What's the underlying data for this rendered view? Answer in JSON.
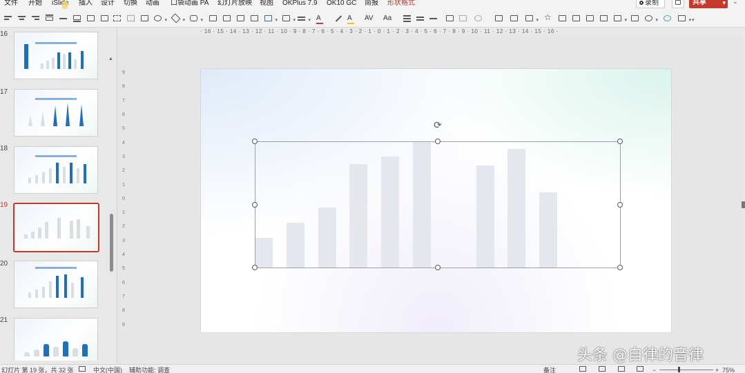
{
  "menu": {
    "items": [
      "文件",
      "开始",
      "iSlide",
      "插入",
      "设计",
      "切换",
      "动画",
      "口袋动画 PA",
      "幻灯片放映",
      "视图",
      "OKPlus 7.9",
      "OK10 GC",
      "简报",
      "形状格式"
    ],
    "active_index": 13,
    "record_label": "录制",
    "share_label": "共享"
  },
  "toolbar": {
    "font_size_label": "Aa",
    "text_color": "#c0392b",
    "highlight_color": "#f1c40f"
  },
  "thumbnails": [
    {
      "number": "16",
      "active": false,
      "style": "blue_bars"
    },
    {
      "number": "17",
      "active": false,
      "style": "triangles"
    },
    {
      "number": "18",
      "active": false,
      "style": "blue_bars_grid"
    },
    {
      "number": "19",
      "active": true,
      "style": "gray_bars"
    },
    {
      "number": "20",
      "active": false,
      "style": "blue_bars_grid"
    },
    {
      "number": "21",
      "active": false,
      "style": "rounded_bars"
    }
  ],
  "ruler": {
    "horizontal": "· 16 · 15 · 14 · 13 · 12 · 11 · 10 · 9 · 8 · 7 · 6 · 5 · 4 · 3 · 2 · 1 · 0 · 1 · 2 · 3 · 4 · 5 · 6 · 7 · 8 · 9 · 10 · 11 · 12 · 13 · 14 · 15 · 16 ·",
    "vertical": [
      "9",
      "8",
      "7",
      "6",
      "5",
      "4",
      "3",
      "2",
      "1",
      "0",
      "1",
      "2",
      "3",
      "4",
      "5",
      "6",
      "7",
      "8",
      "9"
    ]
  },
  "slide_chart": {
    "bar_color": "#e4e8ee",
    "bars": [
      0.24,
      0.36,
      0.48,
      0.82,
      0.88,
      1.0,
      0.0,
      0.81,
      0.94,
      0.6
    ]
  },
  "status": {
    "slide_info": "幻灯片 第 19 张，共 32 张",
    "language": "中文(中国)",
    "accessibility": "辅助功能: 调查",
    "notes": "备注",
    "zoom": "75%"
  },
  "watermark": "头条 @自律的音律"
}
